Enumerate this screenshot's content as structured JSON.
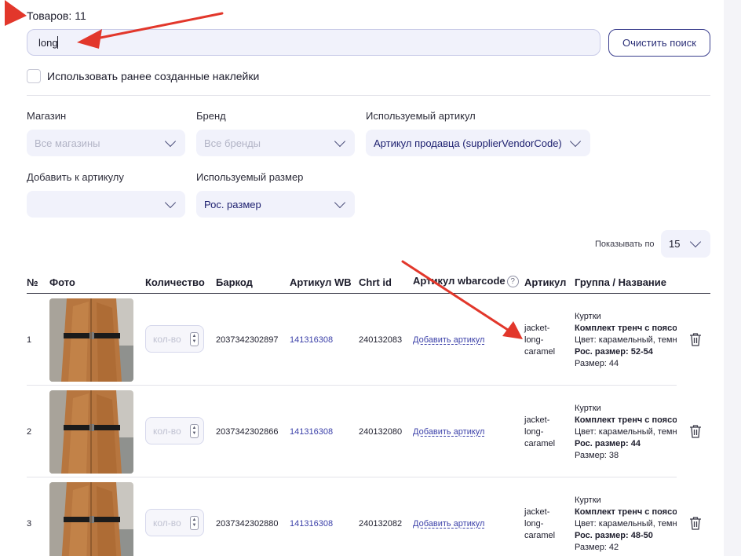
{
  "header": {
    "goods_label": "Товаров:",
    "goods_count": "11"
  },
  "search": {
    "value": "long",
    "clear_label": "Очистить поиск"
  },
  "use_stickers": {
    "label": "Использовать ранее созданные наклейки",
    "checked": false
  },
  "filters": {
    "store": {
      "label": "Магазин",
      "value": "Все магазины"
    },
    "brand": {
      "label": "Бренд",
      "value": "Все бренды"
    },
    "article_used": {
      "label": "Используемый артикул",
      "value": "Артикул продавца (supplierVendorCode)"
    },
    "add_to_article": {
      "label": "Добавить к артикулу",
      "value": ""
    },
    "size_used": {
      "label": "Используемый размер",
      "value": "Рос. размер"
    }
  },
  "pagination": {
    "show_by_label": "Показывать по",
    "show_by_value": "15"
  },
  "table": {
    "columns": {
      "num": "№",
      "photo": "Фото",
      "qty": "Количество",
      "barcode": "Баркод",
      "article_wb": "Артикул WB",
      "chrt_id": "Chrt id",
      "article_wbarcode": "Артикул wbarcode",
      "article": "Артикул",
      "group_name": "Группа / Название"
    },
    "qty_placeholder": "кол-во",
    "add_article_label": "Добавить артикул",
    "rows": [
      {
        "num": "1",
        "barcode": "2037342302897",
        "article_wb": "141316308",
        "chrt_id": "240132083",
        "article_lines": [
          "jacket-",
          "long-",
          "caramel"
        ],
        "group": "Куртки",
        "name": "Комплект тренч с поясом",
        "color": "Цвет: карамельный, темно-",
        "ros_size": "Рос. размер: 52-54",
        "size": "Размер: 44"
      },
      {
        "num": "2",
        "barcode": "2037342302866",
        "article_wb": "141316308",
        "chrt_id": "240132080",
        "article_lines": [
          "jacket-",
          "long-",
          "caramel"
        ],
        "group": "Куртки",
        "name": "Комплект тренч с поясом",
        "color": "Цвет: карамельный, темно-",
        "ros_size": "Рос. размер: 44",
        "size": "Размер: 38"
      },
      {
        "num": "3",
        "barcode": "2037342302880",
        "article_wb": "141316308",
        "chrt_id": "240132082",
        "article_lines": [
          "jacket-",
          "long-",
          "caramel"
        ],
        "group": "Куртки",
        "name": "Комплект тренч с поясом",
        "color": "Цвет: карамельный, темно-",
        "ros_size": "Рос. размер: 48-50",
        "size": "Размер: 42"
      }
    ]
  },
  "colors": {
    "accent": "#3a3fa8",
    "annotation_arrow": "#e2372b",
    "jacket": "#b7763f"
  }
}
